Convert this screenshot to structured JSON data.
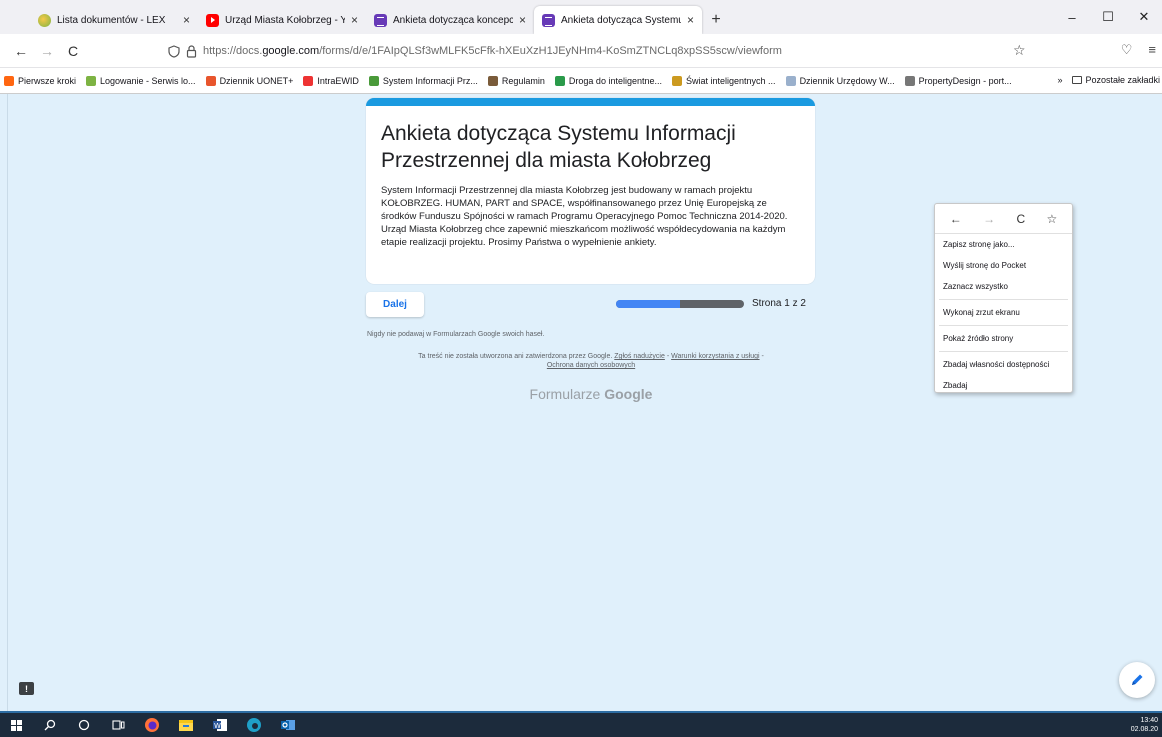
{
  "tabs": [
    {
      "title": "Lista dokumentów - LEX",
      "icon": "lex-icon",
      "active": false
    },
    {
      "title": "Urząd Miasta Kołobrzeg - YouTu",
      "icon": "youtube-icon",
      "active": false
    },
    {
      "title": "Ankieta dotycząca koncepcji Sy",
      "icon": "google-forms-icon",
      "active": false
    },
    {
      "title": "Ankieta dotycząca Systemu Info",
      "icon": "google-forms-icon",
      "active": true
    }
  ],
  "tab_close": "×",
  "new_tab": "+",
  "window_controls": {
    "minimize": "–",
    "maximize": "☐",
    "close": "✕"
  },
  "nav": {
    "back": "←",
    "forward": "→",
    "reload": "C",
    "url_prefix": "https://docs.",
    "url_host": "google.com",
    "url_path": "/forms/d/e/1FAIpQLSf3wMLFK5cFfk-hXEuXzH1JEyNHm4-KoSmZTNCLq8xpSS5scw/viewform",
    "star": "☆",
    "pocket": "♡",
    "menu": "≡"
  },
  "bookmarks": [
    {
      "label": "Pierwsze kroki",
      "color": "#ff6611"
    },
    {
      "label": "Logowanie - Serwis lo...",
      "color": "#7db343"
    },
    {
      "label": "Dziennik UONET+",
      "color": "#e8552d"
    },
    {
      "label": "IntraEWID",
      "color": "#e33"
    },
    {
      "label": "System Informacji Prz...",
      "color": "#4a9a3a"
    },
    {
      "label": "Regulamin",
      "color": "#7a5b3a"
    },
    {
      "label": "Droga do inteligentne...",
      "color": "#2a9a4a"
    },
    {
      "label": "Świat inteligentnych ...",
      "color": "#cc9a20"
    },
    {
      "label": "Dziennik Urzędowy W...",
      "color": "#9ab0cc"
    },
    {
      "label": "PropertyDesign - port...",
      "color": "#777"
    }
  ],
  "bookmarks_overflow": "»",
  "bookmarks_other": "Pozostałe zakładki",
  "form": {
    "title": "Ankieta dotycząca Systemu Informacji Przestrzennej dla miasta Kołobrzeg",
    "description": "System Informacji Przestrzennej dla miasta Kołobrzeg jest budowany w ramach projektu KOŁOBRZEG. HUMAN, PART and SPACE, współfinansowanego przez Unię Europejską ze środków Funduszu Spójności w ramach Programu Operacyjnego Pomoc Techniczna 2014-2020. Urząd Miasta Kołobrzeg chce zapewnić mieszkańcom możliwość współdecydowania na każdym etapie realizacji projektu. Prosimy Państwa o wypełnienie ankiety.",
    "accent_color": "#1a9ae0",
    "next_label": "Dalej",
    "progress_fraction": 0.5,
    "page_label": "Strona 1 z 2",
    "warning": "Nigdy nie podawaj w Formularzach Google swoich haseł.",
    "legal_text": "Ta treść nie została utworzona ani zatwierdzona przez Google.",
    "legal_links": [
      "Zgłoś nadużycie",
      "Warunki korzystania z usługi",
      "Ochrona danych osobowych"
    ],
    "legal_sep": " - ",
    "brand_prefix": "Formularze",
    "brand_name": "Google"
  },
  "context_menu": {
    "nav": {
      "back": "←",
      "forward": "→",
      "reload": "C",
      "bookmark": "☆"
    },
    "items": [
      "Zapisz stronę jako...",
      "Wyślij stronę do Pocket",
      "Zaznacz wszystko",
      "Wykonaj zrzut ekranu",
      "Pokaż źródło strony",
      "Zbadaj własności dostępności",
      "Zbadaj"
    ]
  },
  "feedback_glyph": "!",
  "taskbar": {
    "clock_time": "13:40",
    "clock_date": "02.08.20"
  }
}
